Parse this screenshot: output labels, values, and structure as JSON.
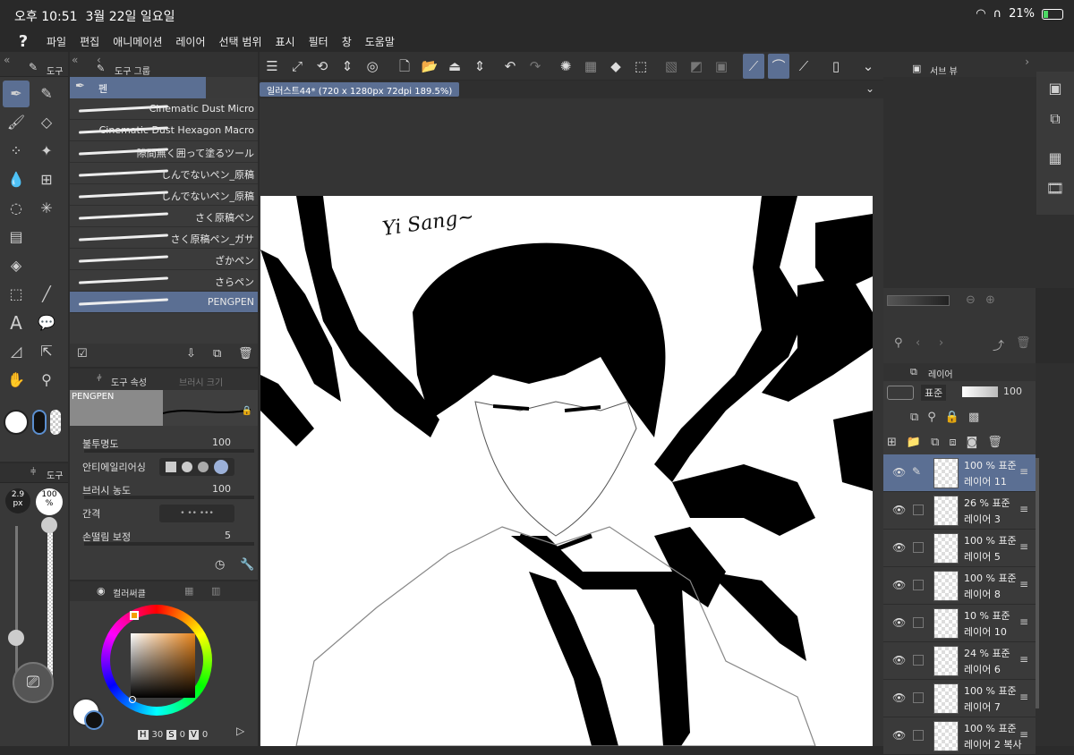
{
  "status": {
    "time": "오후 10:51",
    "date": "3월 22일 일요일",
    "battery": "21%"
  },
  "menu": [
    "파일",
    "편집",
    "애니메이션",
    "레이어",
    "선택 범위",
    "표시",
    "필터",
    "창",
    "도움말"
  ],
  "left_tool_tab": "도구",
  "tool_group_tab": "도구 그룹",
  "pen_group": "펜",
  "brushes": [
    "Cinematic Dust Micro",
    "Cinematic Dust Hexagon Macro",
    "隙間無く囲って塗るツール",
    "しんでないペン_原稿",
    "しんでないペン_原稿",
    "さく原稿ペン",
    "さく原稿ペン_ガサ",
    "ざかペン",
    "さらペン",
    "PENGPEN"
  ],
  "tool_props": {
    "tab": "도구 속성",
    "tab2": "브러시 크기",
    "preview_name": "PENGPEN",
    "opacity_label": "불투명도",
    "opacity": "100",
    "aa_label": "안티에일리어싱",
    "density_label": "브러시 농도",
    "density": "100",
    "spacing_label": "간격",
    "stabilization_label": "손떨림 보정",
    "stabilization": "5"
  },
  "size_tab": "도구",
  "brush_size": "2.9\npx",
  "brush_size_value": "2.9",
  "brush_size_unit": "px",
  "brush_opacity_value": "100",
  "brush_opacity_unit": "%",
  "color_tab": "컬러써클",
  "hsv": {
    "h_label": "H",
    "h": "30",
    "s_label": "S",
    "s": "0",
    "v_label": "V",
    "v": "0"
  },
  "document": {
    "tab": "일러스트44* (720 x 1280px 72dpi 189.5%)"
  },
  "artwork_text": "Yi Sang~",
  "subview_tab": "서브 뷰",
  "layer_panel": {
    "tab": "레이어",
    "blend": "표준",
    "opacity": "100"
  },
  "layers": [
    {
      "pct": "100 % 표준",
      "name": "레이어 11",
      "selected": true
    },
    {
      "pct": "26 % 표준",
      "name": "레이어 3"
    },
    {
      "pct": "100 % 표준",
      "name": "레이어 5"
    },
    {
      "pct": "100 % 표준",
      "name": "레이어 8"
    },
    {
      "pct": "10 % 표준",
      "name": "레이어 10"
    },
    {
      "pct": "24 % 표준",
      "name": "레이어 6"
    },
    {
      "pct": "100 % 표준",
      "name": "레이어 7"
    },
    {
      "pct": "100 % 표준",
      "name": "레이어 2 복사"
    }
  ],
  "colors": {
    "accent": "#5b6f93",
    "panel": "#3a3a3a"
  }
}
